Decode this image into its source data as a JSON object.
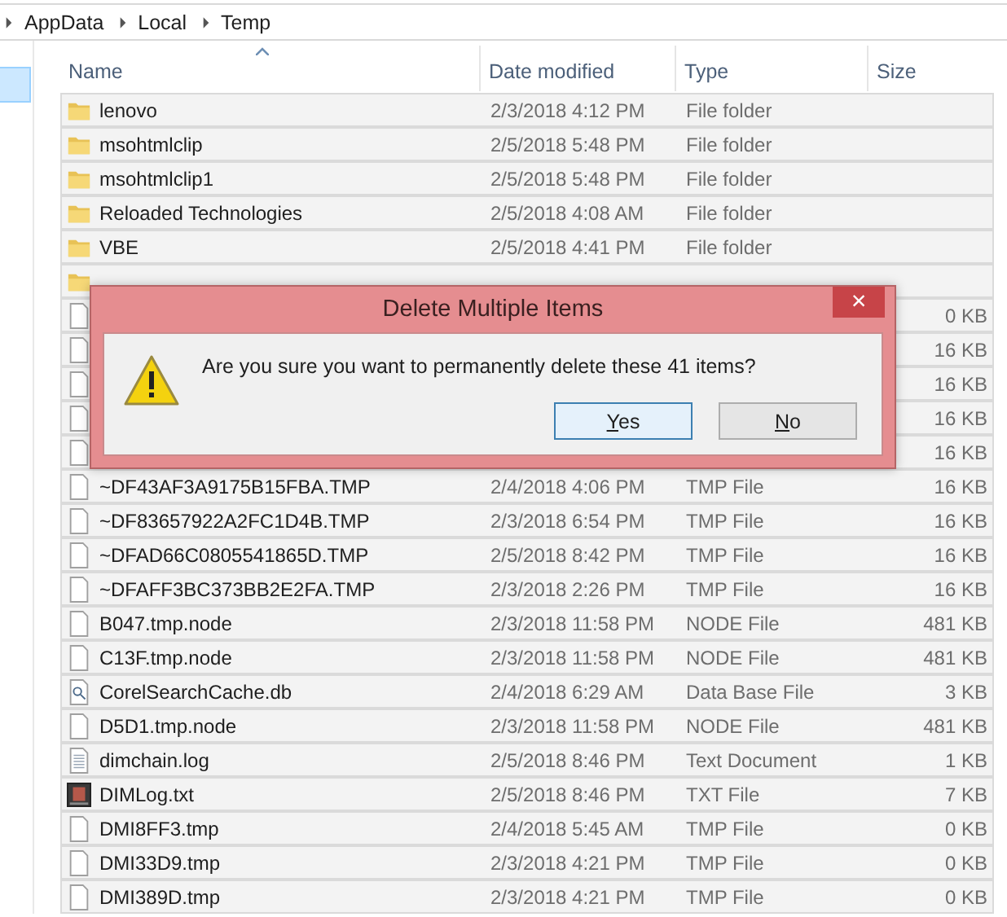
{
  "breadcrumb": [
    "AppData",
    "Local",
    "Temp"
  ],
  "columns": [
    {
      "label": "Name",
      "sorted": true
    },
    {
      "label": "Date modified",
      "sorted": false
    },
    {
      "label": "Type",
      "sorted": false
    },
    {
      "label": "Size",
      "sorted": false
    }
  ],
  "rows": [
    {
      "kind": "folder",
      "name": "lenovo",
      "date": "2/3/2018 4:12 PM",
      "type": "File folder",
      "selected": true
    },
    {
      "kind": "folder",
      "name": "msohtmlclip",
      "date": "2/5/2018 5:48 PM",
      "type": "File folder",
      "selected": true
    },
    {
      "kind": "folder",
      "name": "msohtmlclip1",
      "date": "2/5/2018 5:48 PM",
      "type": "File folder",
      "selected": true
    },
    {
      "kind": "folder",
      "name": "Reloaded Technologies",
      "date": "2/5/2018 4:08 AM",
      "type": "File folder",
      "selected": true
    },
    {
      "kind": "folder",
      "name": "VBE",
      "date": "2/5/2018 4:41 PM",
      "type": "File folder",
      "selected": true
    },
    {
      "kind": "folder",
      "selected": true
    },
    {
      "kind": "file",
      "size": "0 KB",
      "selected": true
    },
    {
      "kind": "file",
      "size": "16 KB",
      "selected": true
    },
    {
      "kind": "file",
      "size": "16 KB",
      "selected": true
    },
    {
      "kind": "file",
      "size": "16 KB",
      "selected": true
    },
    {
      "kind": "file",
      "size": "16 KB",
      "selected": true
    },
    {
      "kind": "file",
      "name": "~DF43AF3A9175B15FBA.TMP",
      "date": "2/4/2018 4:06 PM",
      "type": "TMP File",
      "size": "16 KB",
      "selected": true
    },
    {
      "kind": "file",
      "name": "~DF83657922A2FC1D4B.TMP",
      "date": "2/3/2018 6:54 PM",
      "type": "TMP File",
      "size": "16 KB",
      "selected": true
    },
    {
      "kind": "file",
      "name": "~DFAD66C0805541865D.TMP",
      "date": "2/5/2018 8:42 PM",
      "type": "TMP File",
      "size": "16 KB",
      "selected": true
    },
    {
      "kind": "file",
      "name": "~DFAFF3BC373BB2E2FA.TMP",
      "date": "2/3/2018 2:26 PM",
      "type": "TMP File",
      "size": "16 KB",
      "selected": true
    },
    {
      "kind": "file",
      "name": "B047.tmp.node",
      "date": "2/3/2018 11:58 PM",
      "type": "NODE File",
      "size": "481 KB",
      "selected": true
    },
    {
      "kind": "file",
      "name": "C13F.tmp.node",
      "date": "2/3/2018 11:58 PM",
      "type": "NODE File",
      "size": "481 KB",
      "selected": true
    },
    {
      "kind": "database",
      "name": "CorelSearchCache.db",
      "date": "2/4/2018 6:29 AM",
      "type": "Data Base File",
      "size": "3 KB",
      "selected": true
    },
    {
      "kind": "file",
      "name": "D5D1.tmp.node",
      "date": "2/3/2018 11:58 PM",
      "type": "NODE File",
      "size": "481 KB",
      "selected": true
    },
    {
      "kind": "text",
      "name": "dimchain.log",
      "date": "2/5/2018 8:46 PM",
      "type": "Text Document",
      "size": "1 KB",
      "selected": true
    },
    {
      "kind": "app",
      "name": "DIMLog.txt",
      "date": "2/5/2018 8:46 PM",
      "type": "TXT File",
      "size": "7 KB",
      "selected": true
    },
    {
      "kind": "file",
      "name": "DMI8FF3.tmp",
      "date": "2/4/2018 5:45 AM",
      "type": "TMP File",
      "size": "0 KB",
      "selected": true
    },
    {
      "kind": "file",
      "name": "DMI33D9.tmp",
      "date": "2/3/2018 4:21 PM",
      "type": "TMP File",
      "size": "0 KB",
      "selected": true
    },
    {
      "kind": "file",
      "name": "DMI389D.tmp",
      "date": "2/3/2018 4:21 PM",
      "type": "TMP File",
      "size": "0 KB",
      "selected": true
    }
  ],
  "dialog": {
    "title": "Delete Multiple Items",
    "close": "×",
    "message": "Are you sure you want to permanently delete these 41 items?",
    "buttons": [
      {
        "label": "Yes",
        "focused": true
      },
      {
        "label": "No",
        "focused": false
      }
    ]
  }
}
